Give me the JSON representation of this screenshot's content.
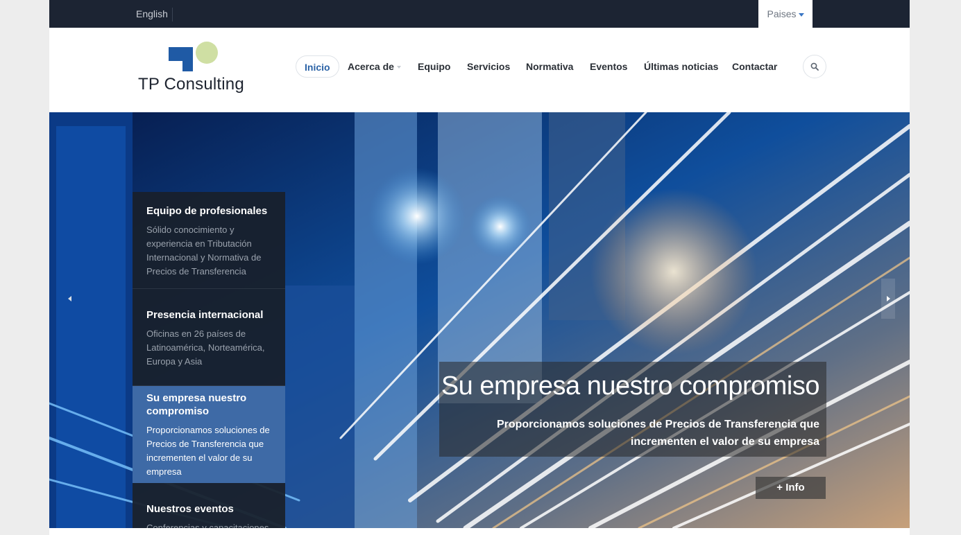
{
  "topbar": {
    "language": "English",
    "countries": "Paises"
  },
  "header": {
    "logo_text": "TP Consulting",
    "nav": [
      {
        "label": "Inicio"
      },
      {
        "label": "Acerca de"
      },
      {
        "label": "Equipo"
      },
      {
        "label": "Servicios"
      },
      {
        "label": "Normativa"
      },
      {
        "label": "Eventos"
      },
      {
        "label": "Últimas noticias"
      },
      {
        "label": "Contactar"
      }
    ]
  },
  "slider": {
    "items": [
      {
        "title": "Equipo de profesionales",
        "text": "Sólido conocimiento y experiencia en Tributación Internacional y Normativa de Precios de Transferencia"
      },
      {
        "title": "Presencia internacional",
        "text": "Oficinas en 26 países de Latinoamérica, Norteamérica, Europa y Asia"
      },
      {
        "title": "Su empresa nuestro compromiso",
        "text": "Proporcionamos soluciones de Precios de Transferencia que incrementen el valor de su empresa"
      },
      {
        "title": "Nuestros eventos",
        "text": "Conferencias y capacitaciones"
      }
    ],
    "caption_title": "Su empresa nuestro compromiso",
    "caption_text": "Proporcionamos soluciones de Precios de Transferencia que incrementen el valor de su empresa",
    "info_button": "+ Info"
  },
  "colors": {
    "topbar": "#1c2433",
    "brand_blue": "#1f5aa5",
    "logo_green": "#cfdfa3",
    "active_panel": "#3e6aa6"
  }
}
